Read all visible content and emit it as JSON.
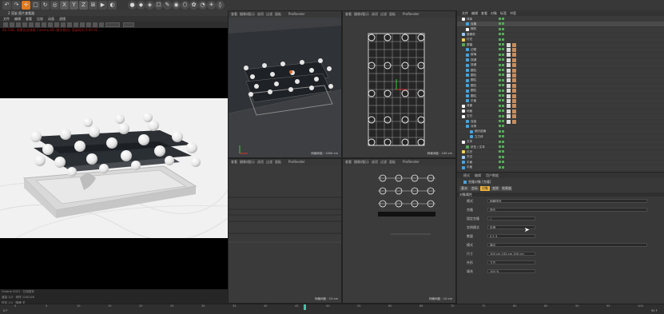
{
  "toolbar": {
    "buttons": [
      "↶",
      "↷",
      "✛",
      "□",
      "↻",
      "◎",
      "X",
      "Y",
      "Z",
      "⊞",
      "▶",
      "◐",
      "●",
      "◆",
      "◈",
      "☐",
      "✎",
      "◉",
      "⬡",
      "✿",
      "◔",
      "☀",
      "◊"
    ]
  },
  "render_view": {
    "title": "2 渲染 图片查看器",
    "menu": [
      "文件",
      "编辑",
      "查看",
      "比较",
      "动画",
      "滤镜"
    ],
    "info_text": "RS C4D, 场景包含线框 Cinema 4D (数字格式) 渲染时间 0:00:02 ...",
    "stats": [
      "Octane 2021 · 已用显存",
      "渲染 2/2 · 采样 128/128",
      "样本 1/1 · 降噪 关",
      "已用时间 0:02"
    ]
  },
  "viewports": [
    {
      "menu": [
        "查看",
        "摄像机",
        "显示",
        "选项",
        "过滤",
        "面板",
        "ProRender"
      ],
      "label": "透视视图",
      "status": "网格间距 : 1000 cm"
    },
    {
      "menu": [
        "查看",
        "摄像机",
        "显示",
        "选项",
        "过滤",
        "面板",
        "ProRender"
      ],
      "label": "顶视图",
      "status": "网格间距 : 100 cm"
    },
    {
      "menu": [
        "查看",
        "摄像机",
        "显示",
        "选项",
        "过滤",
        "面板",
        "ProRender"
      ],
      "label": "右视图",
      "status": "网格间距 : 10 cm"
    },
    {
      "menu": [
        "查看",
        "摄像机",
        "显示",
        "选项",
        "过滤",
        "面板",
        "ProRender"
      ],
      "label": "正视图",
      "status": "网格间距 : 10 cm"
    }
  ],
  "object_manager": {
    "tabs": [
      "文件",
      "编辑",
      "查看",
      "对象",
      "标签",
      "书签"
    ],
    "rows": [
      {
        "name": "球体",
        "indent": 0,
        "color": "#ffffff"
      },
      {
        "name": "克隆",
        "indent": 1,
        "color": "#4ba3d9"
      },
      {
        "name": "随机",
        "indent": 1,
        "color": "#ffffff"
      },
      {
        "name": "摄像机",
        "indent": 0,
        "color": "#9ecbf5"
      },
      {
        "name": "灯光",
        "indent": 0,
        "color": "#f0d35a"
      },
      {
        "name": "屏幕",
        "indent": 0,
        "color": "#59a85b"
      },
      {
        "name": "边框",
        "indent": 1,
        "color": "#4ba3d9"
      },
      {
        "name": "玻璃",
        "indent": 1,
        "color": "#4ba3d9"
      },
      {
        "name": "按键",
        "indent": 1,
        "color": "#4ba3d9"
      },
      {
        "name": "按键",
        "indent": 1,
        "color": "#4ba3d9"
      },
      {
        "name": "圆柱",
        "indent": 1,
        "color": "#4ba3d9"
      },
      {
        "name": "圆柱",
        "indent": 1,
        "color": "#4ba3d9"
      },
      {
        "name": "圆柱",
        "indent": 1,
        "color": "#4ba3d9"
      },
      {
        "name": "圆柱",
        "indent": 1,
        "color": "#4ba3d9"
      },
      {
        "name": "圆柱",
        "indent": 1,
        "color": "#4ba3d9"
      },
      {
        "name": "圆柱",
        "indent": 1,
        "color": "#4ba3d9"
      },
      {
        "name": "平面",
        "indent": 1,
        "color": "#4ba3d9"
      },
      {
        "name": "背景",
        "indent": 0,
        "color": "#ffffff"
      },
      {
        "name": "地面",
        "indent": 0,
        "color": "#ffffff"
      },
      {
        "name": "空白",
        "indent": 0,
        "color": "#ffffff"
      },
      {
        "name": "连接",
        "indent": 1,
        "color": "#4ba3d9"
      },
      {
        "name": "对称",
        "indent": 1,
        "color": "#4ba3d9"
      },
      {
        "name": "细分曲面",
        "indent": 2,
        "color": "#4ba3d9"
      },
      {
        "name": "立方体",
        "indent": 2,
        "color": "#4ba3d9"
      },
      {
        "name": "文本",
        "indent": 0,
        "color": "#ffffff"
      },
      {
        "name": "挤压 / 文本",
        "indent": 1,
        "color": "#59a85b"
      },
      {
        "name": "灯光",
        "indent": 0,
        "color": "#f0d35a"
      },
      {
        "name": "天空",
        "indent": 0,
        "color": "#9ecbf5"
      },
      {
        "name": "平面",
        "indent": 0,
        "color": "#4ba3d9"
      },
      {
        "name": "平面",
        "indent": 0,
        "color": "#4ba3d9"
      }
    ]
  },
  "attribute_manager": {
    "menu": [
      "模式",
      "编辑",
      "用户数据"
    ],
    "object_title": "克隆对象 [克隆]",
    "tabs": [
      "基本",
      "坐标",
      "对象",
      "变换",
      "效果器"
    ],
    "active_tab": "对象",
    "section": "对象属性",
    "rows": [
      {
        "label": "模式",
        "value": "网格排列"
      },
      {
        "label": "克隆",
        "value": "迭代"
      },
      {
        "label": "固定克隆",
        "value": "✓"
      },
      {
        "label": "实例模式",
        "value": "实例"
      },
      {
        "label": "数量",
        "value": "4    2    3"
      },
      {
        "label": "模式",
        "value": "端点"
      },
      {
        "label": "尺寸",
        "value": "100 cm   100 cm   100 cm"
      },
      {
        "label": "外形",
        "value": "立方"
      },
      {
        "label": "填充",
        "value": "100 %"
      }
    ]
  },
  "timeline": {
    "ticks": [
      "0",
      "5",
      "10",
      "15",
      "20",
      "25",
      "30",
      "35",
      "40",
      "45",
      "50",
      "55",
      "60",
      "65",
      "70",
      "75",
      "80",
      "85",
      "90",
      "95",
      "100"
    ],
    "frame": "0 F",
    "end": "90 F"
  },
  "colors": {
    "accent": "#f0b33a",
    "panel": "#383838",
    "viewport": "#3b3b3b"
  }
}
